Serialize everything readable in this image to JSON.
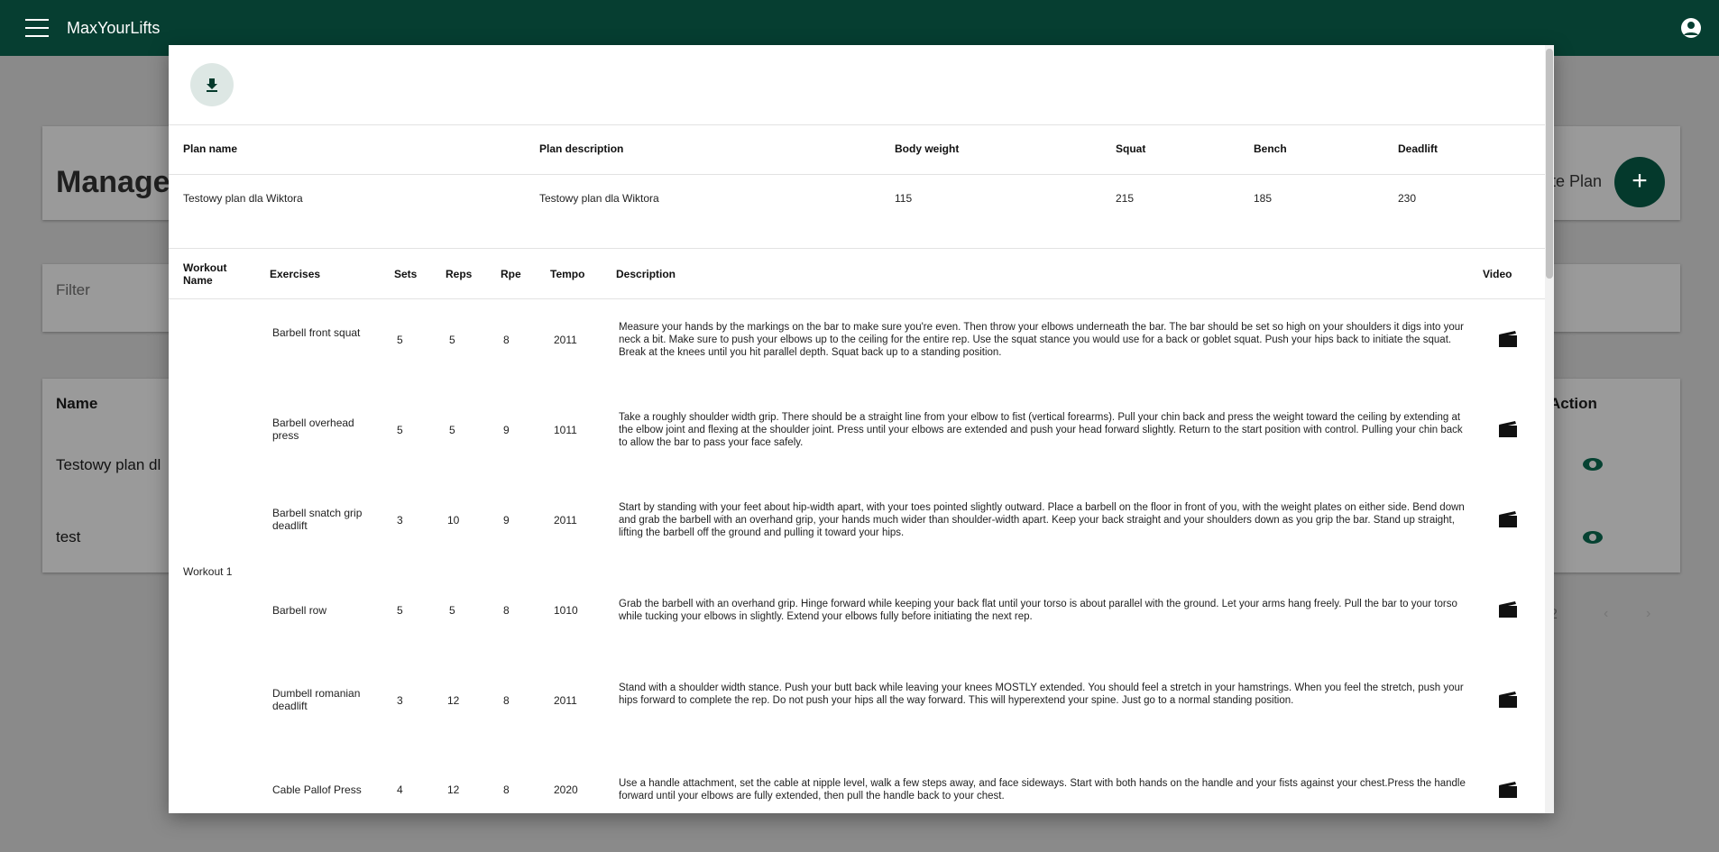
{
  "app": {
    "title": "MaxYourLifts"
  },
  "background": {
    "page_title": "Manage",
    "create_plan_label": "te Plan",
    "fab_label": "+",
    "filter_placeholder": "Filter",
    "table": {
      "name_header": "Name",
      "action_header": "Action",
      "rows": [
        "Testowy plan dl",
        "test"
      ]
    },
    "pagination": {
      "range_fragment": "2",
      "prev": "‹",
      "next": "›"
    }
  },
  "modal": {
    "plan_table": {
      "headers": {
        "plan_name": "Plan name",
        "plan_description": "Plan description",
        "body_weight": "Body weight",
        "squat": "Squat",
        "bench": "Bench",
        "deadlift": "Deadlift"
      },
      "row": {
        "plan_name": "Testowy plan dla Wiktora",
        "plan_description": "Testowy plan dla Wiktora",
        "body_weight": "115",
        "squat": "215",
        "bench": "185",
        "deadlift": "230"
      }
    },
    "workout_table": {
      "headers": {
        "workout_name": "Workout Name",
        "exercises": "Exercises",
        "sets": "Sets",
        "reps": "Reps",
        "rpe": "Rpe",
        "tempo": "Tempo",
        "description": "Description",
        "video": "Video"
      },
      "workout_name": "Workout 1",
      "rows": [
        {
          "exercise": "Barbell front squat",
          "sets": "5",
          "reps": "5",
          "rpe": "8",
          "tempo": "2011",
          "description": "Measure your hands by the markings on the bar to make sure you're even. Then throw your elbows underneath the bar. The bar should be set so high on your shoulders it digs into your neck a bit. Make sure to push your elbows up to the ceiling for the entire rep. Use the squat stance you would use for a back or goblet squat. Push your hips back to initiate the squat. Break at the knees until you hit parallel depth. Squat back up to a standing position."
        },
        {
          "exercise": "Barbell overhead press",
          "sets": "5",
          "reps": "5",
          "rpe": "9",
          "tempo": "1011",
          "description": "Take a roughly shoulder width grip. There should be a straight line from your elbow to fist (vertical forearms). Pull your chin back and press the weight toward the ceiling by extending at the elbow joint and flexing at the shoulder joint. Press until your elbows are extended and push your head forward slightly. Return to the start position with control. Pulling your chin back to allow the bar to pass your face safely."
        },
        {
          "exercise": "Barbell snatch grip deadlift",
          "sets": "3",
          "reps": "10",
          "rpe": "9",
          "tempo": "2011",
          "description": "Start by standing with your feet about hip-width apart, with your toes pointed slightly outward. Place a barbell on the floor in front of you, with the weight plates on either side. Bend down and grab the barbell with an overhand grip, your hands much wider than shoulder-width apart. Keep your back straight and your shoulders down as you grip the bar. Stand up straight, lifting the barbell off the ground and pulling it toward your hips."
        },
        {
          "exercise": "Barbell row",
          "sets": "5",
          "reps": "5",
          "rpe": "8",
          "tempo": "1010",
          "description": "Grab the barbell with an overhand grip. Hinge forward while keeping your back flat until your torso is about parallel with the ground. Let your arms hang freely. Pull the bar to your torso while tucking your elbows in slightly. Extend your elbows fully before initiating the next rep."
        },
        {
          "exercise": "Dumbell romanian deadlift",
          "sets": "3",
          "reps": "12",
          "rpe": "8",
          "tempo": "2011",
          "description": "Stand with a shoulder width stance. Push your butt back while leaving your knees MOSTLY extended. You should feel a stretch in your hamstrings. When you feel the stretch, push your hips forward to complete the rep. Do not push your hips all the way forward. This will hyperextend your spine. Just go to a normal standing position."
        },
        {
          "exercise": "Cable Pallof Press",
          "sets": "4",
          "reps": "12",
          "rpe": "8",
          "tempo": "2020",
          "description": "Use a handle attachment, set the cable at nipple level, walk a few steps away, and face sideways. Start with both hands on the handle and your fists against your chest.Press the handle forward until your elbows are fully extended, then pull the handle back to your chest."
        }
      ]
    }
  }
}
